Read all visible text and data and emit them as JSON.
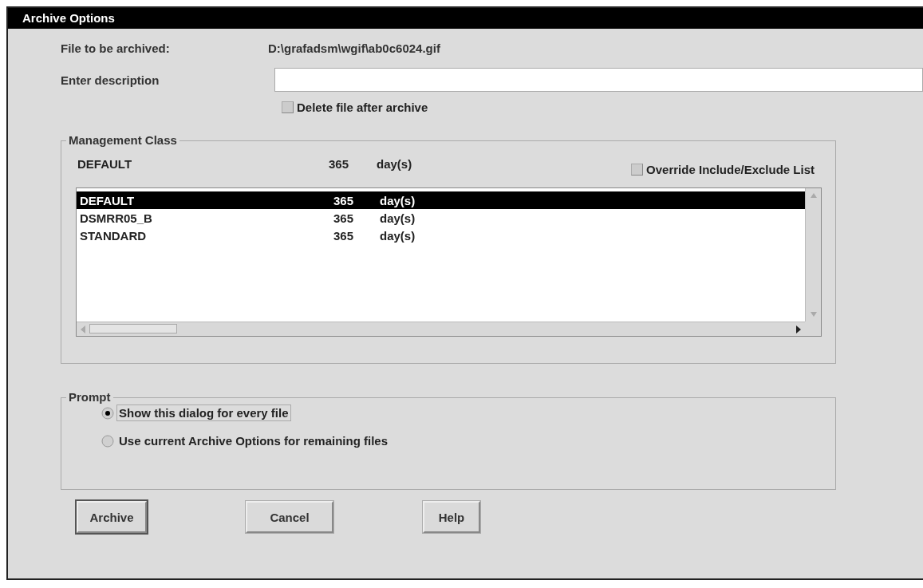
{
  "window": {
    "title": "Archive Options"
  },
  "file": {
    "label": "File to be archived:",
    "value": "D:\\grafadsm\\wgif\\ab0c6024.gif"
  },
  "description": {
    "label": "Enter description"
  },
  "delete_after": {
    "label": "Delete file after archive",
    "checked": false
  },
  "management_class": {
    "title": "Management Class",
    "current": {
      "name": "DEFAULT",
      "retention": "365",
      "unit": "day(s)"
    },
    "override": {
      "label": "Override Include/Exclude List",
      "checked": false
    },
    "list": [
      {
        "name": "DEFAULT",
        "retention": "365",
        "unit": "day(s)",
        "selected": true
      },
      {
        "name": "DSMRR05_B",
        "retention": "365",
        "unit": "day(s)",
        "selected": false
      },
      {
        "name": "STANDARD",
        "retention": "365",
        "unit": "day(s)",
        "selected": false
      }
    ]
  },
  "prompt": {
    "title": "Prompt",
    "options": [
      {
        "label": "Show this dialog for every file",
        "selected": true
      },
      {
        "label": "Use current Archive Options for remaining files",
        "selected": false
      }
    ]
  },
  "buttons": [
    {
      "label": "Archive",
      "default": true
    },
    {
      "label": "Cancel",
      "default": false
    },
    {
      "label": "Help",
      "default": false
    }
  ]
}
